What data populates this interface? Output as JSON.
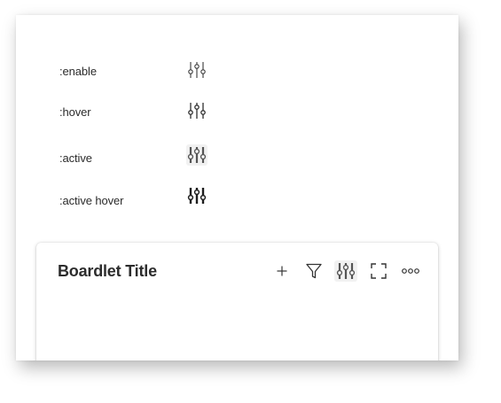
{
  "states": [
    {
      "label": ":enable",
      "icon": "sliders-icon",
      "state": "enable"
    },
    {
      "label": ":hover",
      "icon": "sliders-icon",
      "state": "hover"
    },
    {
      "label": ":active",
      "icon": "sliders-icon",
      "state": "active"
    },
    {
      "label": ":active hover",
      "icon": "sliders-icon",
      "state": "active-hover"
    }
  ],
  "boardlet": {
    "title": "Boardlet Title",
    "toolbar": [
      {
        "icon": "plus-icon",
        "name": "add-button"
      },
      {
        "icon": "filter-icon",
        "name": "filter-button"
      },
      {
        "icon": "sliders-icon",
        "name": "settings-button"
      },
      {
        "icon": "fullscreen-icon",
        "name": "fullscreen-button"
      },
      {
        "icon": "more-icon",
        "name": "more-button"
      }
    ]
  },
  "colors": {
    "text": "#2b2b2b",
    "icon": "#3a3a3a",
    "icon_active": "#2a2a2a",
    "hover_bg": "#f1f1f1"
  }
}
